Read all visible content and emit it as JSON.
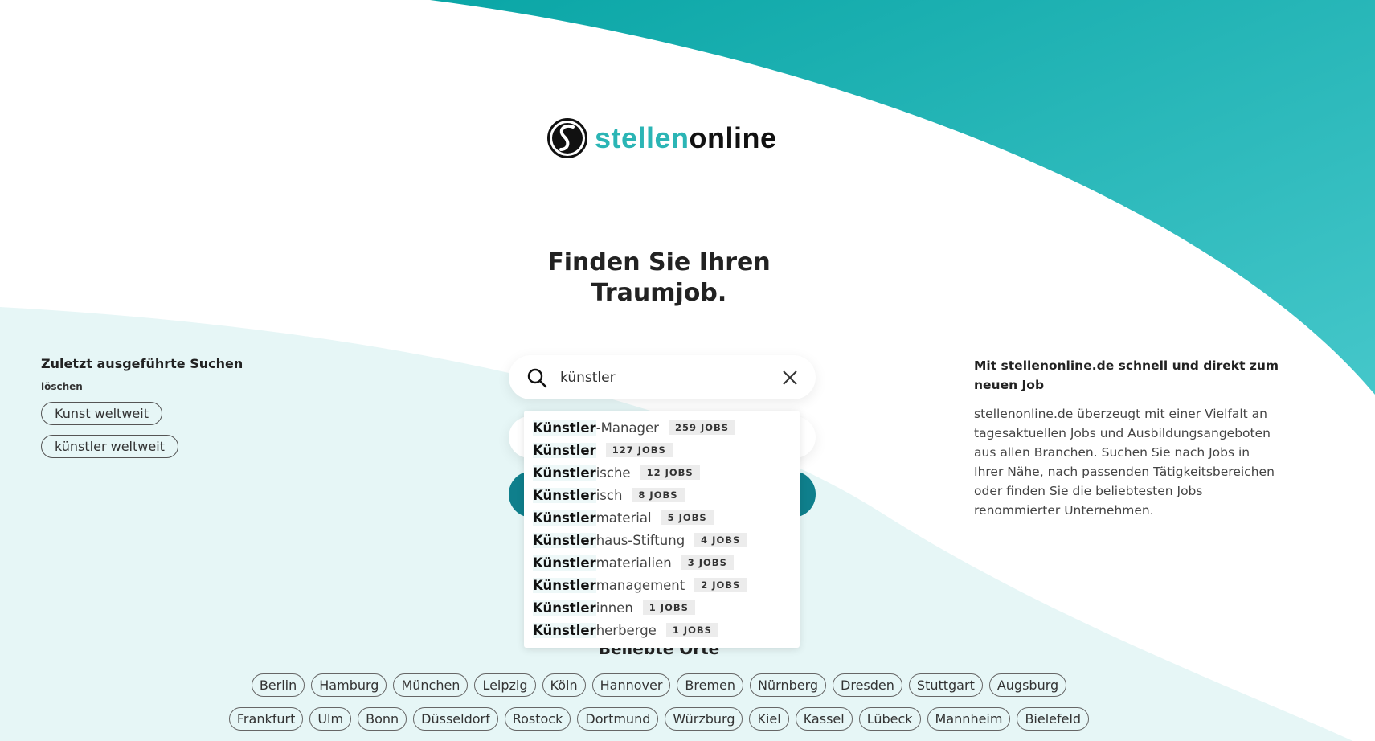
{
  "colors": {
    "teal_dark": "#0fa8a8",
    "teal_light": "#40c5c8",
    "mint": "#e6f6f6",
    "button": "#0f7f8c"
  },
  "logo": {
    "text_part1": "stellen",
    "text_part2": "online",
    "icon": "stellenonline-s-logo"
  },
  "headline": {
    "line1": "Finden Sie Ihren",
    "line2": "Traumjob."
  },
  "recent": {
    "title": "Zuletzt ausgeführte Suchen",
    "clear": "löschen",
    "items": [
      "Kunst weltweit",
      "künstler weltweit"
    ]
  },
  "search": {
    "value": "künstler",
    "icon": "search-icon",
    "clear_icon": "close-icon"
  },
  "suggestions": [
    {
      "bold": "Künstler",
      "rest": "-Manager",
      "count": "259 JOBS"
    },
    {
      "bold": "Künstler",
      "rest": "",
      "count": "127 JOBS"
    },
    {
      "bold": "Künstler",
      "rest": "ische",
      "count": "12 JOBS"
    },
    {
      "bold": "Künstler",
      "rest": "isch",
      "count": "8 JOBS"
    },
    {
      "bold": "Künstler",
      "rest": "material",
      "count": "5 JOBS"
    },
    {
      "bold": "Künstler",
      "rest": "haus-Stiftung",
      "count": "4 JOBS"
    },
    {
      "bold": "Künstler",
      "rest": "materialien",
      "count": "3 JOBS"
    },
    {
      "bold": "Künstler",
      "rest": "management",
      "count": "2 JOBS"
    },
    {
      "bold": "Künstler",
      "rest": "innen",
      "count": "1 JOBS"
    },
    {
      "bold": "Künstler",
      "rest": "herberge",
      "count": "1 JOBS"
    }
  ],
  "info": {
    "title": "Mit stellenonline.de schnell und direkt zum neuen Job",
    "text": "stellenonline.de überzeugt mit einer Vielfalt an tagesaktuellen Jobs und Ausbildungsangeboten aus allen Branchen. Suchen Sie nach Jobs in Ihrer Nähe, nach passenden Tätigkeitsbereichen oder finden Sie die beliebtesten Jobs renommierter Unternehmen."
  },
  "places": {
    "title": "Beliebte Orte",
    "row1": [
      "Berlin",
      "Hamburg",
      "München",
      "Leipzig",
      "Köln",
      "Hannover",
      "Bremen",
      "Nürnberg",
      "Dresden",
      "Stuttgart",
      "Augsburg"
    ],
    "row2": [
      "Frankfurt",
      "Ulm",
      "Bonn",
      "Düsseldorf",
      "Rostock",
      "Dortmund",
      "Würzburg",
      "Kiel",
      "Kassel",
      "Lübeck",
      "Mannheim",
      "Bielefeld"
    ]
  }
}
